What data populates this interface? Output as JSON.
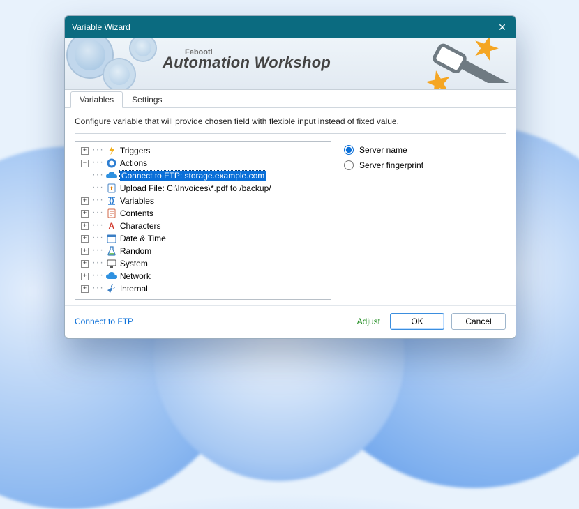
{
  "window": {
    "title": "Variable Wizard"
  },
  "banner": {
    "brand_sub": "Febooti",
    "brand_main": "Automation Workshop"
  },
  "tabs": {
    "variables": "Variables",
    "settings": "Settings",
    "active": "variables"
  },
  "description": "Configure variable that will provide chosen field with flexible input instead of fixed value.",
  "tree": {
    "triggers": "Triggers",
    "actions": "Actions",
    "action_ftp": "Connect to FTP: storage.example.com",
    "action_upload": "Upload File: C:\\Invoices\\*.pdf to /backup/",
    "variables": "Variables",
    "contents": "Contents",
    "characters": "Characters",
    "datetime": "Date & Time",
    "random": "Random",
    "system": "System",
    "network": "Network",
    "internal": "Internal"
  },
  "radios": {
    "server_name": "Server name",
    "server_fingerprint": "Server fingerprint",
    "selected": "server_name"
  },
  "footer": {
    "context": "Connect to FTP",
    "adjust": "Adjust",
    "ok": "OK",
    "cancel": "Cancel"
  }
}
